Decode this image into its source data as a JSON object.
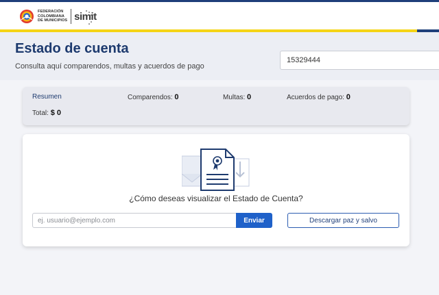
{
  "header": {
    "logo_org_lines": [
      "FEDERACIÓN",
      "COLOMBIANA",
      "DE MUNICIPIOS"
    ],
    "logo_product": "simit",
    "colors": {
      "navy": "#1f3f7a",
      "yellow": "#f5d416",
      "link_blue": "#1f61c9"
    }
  },
  "hero": {
    "title": "Estado de cuenta",
    "subtitle": "Consulta aquí comparendos, multas y acuerdos de pago",
    "search_value": "15329444"
  },
  "summary": {
    "tab_label": "Resumen",
    "comparendos_label": "Comparendos:",
    "comparendos_value": "0",
    "multas_label": "Multas:",
    "multas_value": "0",
    "acuerdos_label": "Acuerdos de pago:",
    "acuerdos_value": "0",
    "total_label": "Total:",
    "total_value": "$ 0"
  },
  "card": {
    "illustration_icon": "document-certificate-icon",
    "question": "¿Cómo deseas visualizar el Estado de Cuenta?",
    "email_placeholder": "ej. usuario@ejemplo.com",
    "send_label": "Enviar",
    "download_label": "Descargar paz y salvo"
  }
}
